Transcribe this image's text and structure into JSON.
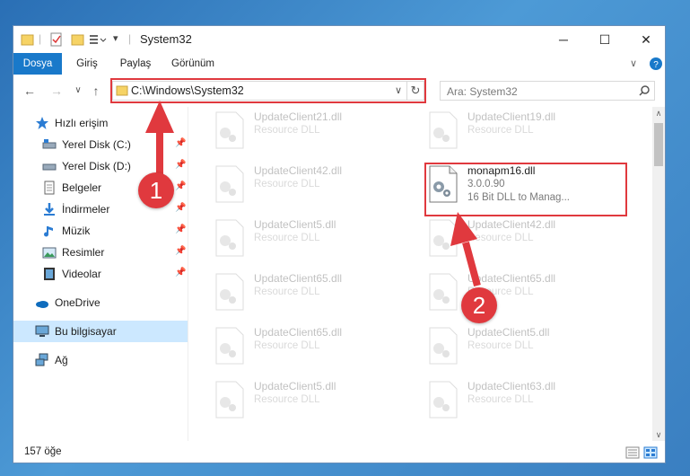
{
  "window": {
    "title": "System32"
  },
  "ribbon": {
    "tabs": [
      {
        "label": "Dosya"
      },
      {
        "label": "Giriş"
      },
      {
        "label": "Paylaş"
      },
      {
        "label": "Görünüm"
      }
    ]
  },
  "address": {
    "path": "C:\\Windows\\System32",
    "search_placeholder": "Ara: System32"
  },
  "sidebar": {
    "items": [
      {
        "label": "Hızlı erişim"
      },
      {
        "label": "Yerel Disk (C:)"
      },
      {
        "label": "Yerel Disk (D:)"
      },
      {
        "label": "Belgeler"
      },
      {
        "label": "İndirmeler"
      },
      {
        "label": "Müzik"
      },
      {
        "label": "Resimler"
      },
      {
        "label": "Videolar"
      },
      {
        "label": "OneDrive"
      },
      {
        "label": "Bu bilgisayar"
      },
      {
        "label": "Ağ"
      }
    ]
  },
  "files": {
    "col1": [
      {
        "name": "UpdateClient21.dll",
        "type": "Resource DLL"
      },
      {
        "name": "UpdateClient42.dll",
        "type": "Resource DLL"
      },
      {
        "name": "UpdateClient5.dll",
        "type": "Resource DLL"
      },
      {
        "name": "UpdateClient65.dll",
        "type": "Resource DLL"
      },
      {
        "name": "UpdateClient65.dll",
        "type": "Resource DLL"
      },
      {
        "name": "UpdateClient5.dll",
        "type": "Resource DLL"
      }
    ],
    "col2": [
      {
        "name": "UpdateClient19.dll",
        "type": "Resource DLL"
      },
      {
        "name": "monapm16.dll",
        "version": "3.0.0.90",
        "type": "16 Bit DLL to Manag..."
      },
      {
        "name": "UpdateClient42.dll",
        "type": "Resource DLL"
      },
      {
        "name": "UpdateClient65.dll",
        "type": "Resource DLL"
      },
      {
        "name": "UpdateClient5.dll",
        "type": "Resource DLL"
      },
      {
        "name": "UpdateClient63.dll",
        "type": "Resource DLL"
      }
    ]
  },
  "status": {
    "count": "157 öğe"
  },
  "annotations": {
    "badge1": "1",
    "badge2": "2"
  },
  "colors": {
    "accent": "#1979ca",
    "highlight": "#e0393e",
    "selected": "#cce8ff"
  }
}
